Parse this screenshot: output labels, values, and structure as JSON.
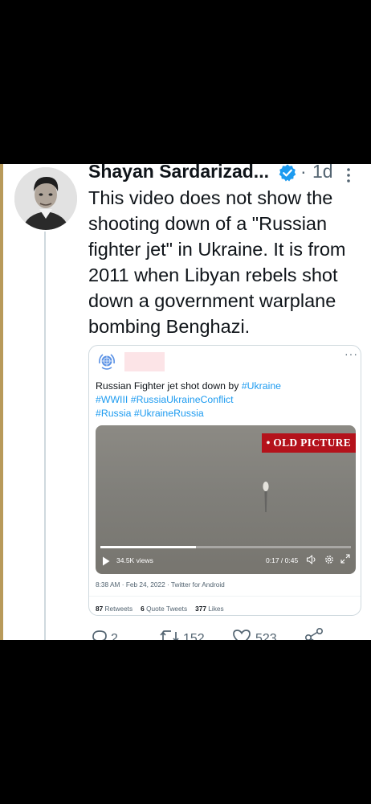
{
  "tweet": {
    "author_name": "Shayan Sardarizad...",
    "time_sep": "·",
    "time": "1d",
    "text": "This video does not show the shooting down of a \"Russian fighter jet\" in Ukraine. It is from 2011 when Libyan rebels shot down a government warplane bombing Benghazi."
  },
  "quote": {
    "more": "···",
    "text_intro": "Russian Fighter jet shot down by ",
    "hashtags": [
      "#Ukraine",
      "#WWIII",
      "#RussiaUkraineConflict",
      "#Russia",
      "#UkraineRussia"
    ],
    "video": {
      "badge": "• OLD PICTURE",
      "views": "34.5K views",
      "time": "0:17 / 0:45",
      "progress": 0.38
    },
    "meta": "8:38 AM · Feb 24, 2022 · Twitter for Android",
    "stats": {
      "retweets_count": "87",
      "retweets_label": "Retweets",
      "quotes_count": "6",
      "quotes_label": "Quote Tweets",
      "likes_count": "377",
      "likes_label": "Likes"
    }
  },
  "actions": {
    "reply_count": "2",
    "retweet_count": "152",
    "like_count": "523"
  },
  "colors": {
    "link": "#1d9bf0",
    "badge": "#b4121b",
    "verified": "#1d9bf0"
  }
}
